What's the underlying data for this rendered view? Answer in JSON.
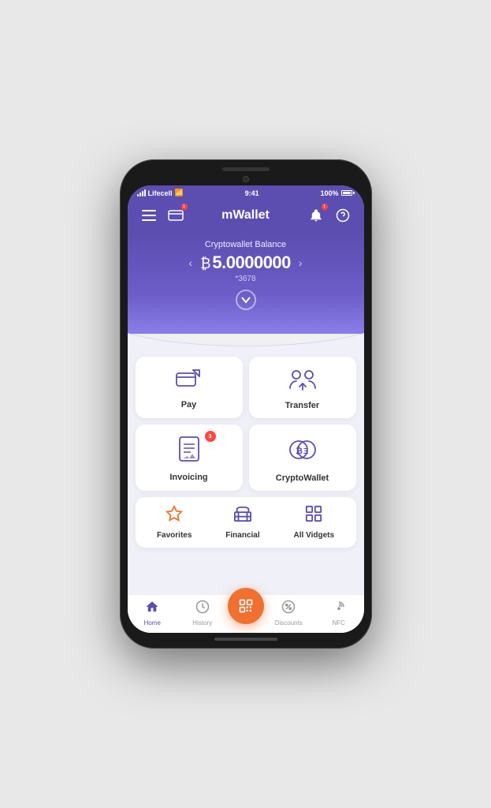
{
  "status_bar": {
    "carrier": "Lifecell",
    "time": "9:41",
    "battery": "100%"
  },
  "header": {
    "title": "mWallet",
    "menu_label": "menu",
    "card_label": "card",
    "bell_label": "notifications",
    "help_label": "help"
  },
  "balance": {
    "label": "Cryptowallet Balance",
    "currency_symbol": "₿",
    "amount": "5.0000000",
    "account": "*3678",
    "prev_label": "‹",
    "next_label": "›"
  },
  "cards": [
    {
      "id": "pay",
      "label": "Pay",
      "badge": null
    },
    {
      "id": "transfer",
      "label": "Transfer",
      "badge": null
    },
    {
      "id": "invoicing",
      "label": "Invoicing",
      "badge": "3"
    },
    {
      "id": "cryptowallet",
      "label": "CryptoWallet",
      "badge": null
    }
  ],
  "quick_actions": [
    {
      "id": "favorites",
      "label": "Favorites"
    },
    {
      "id": "financial",
      "label": "Financial"
    },
    {
      "id": "all-vidgets",
      "label": "All Vidgets"
    }
  ],
  "bottom_nav": [
    {
      "id": "home",
      "label": "Home",
      "active": true
    },
    {
      "id": "history",
      "label": "History",
      "active": false
    },
    {
      "id": "scan",
      "label": "",
      "active": false,
      "center": true
    },
    {
      "id": "discounts",
      "label": "Discounts",
      "active": false
    },
    {
      "id": "nfc",
      "label": "NFC",
      "active": false
    }
  ]
}
